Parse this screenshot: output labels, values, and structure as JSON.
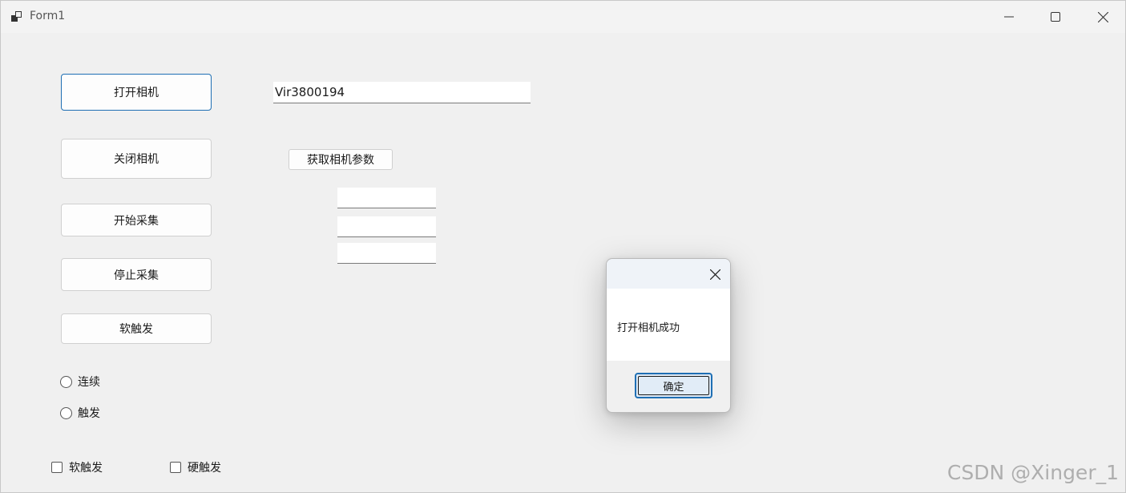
{
  "window": {
    "title": "Form1"
  },
  "buttons": {
    "open_camera": "打开相机",
    "close_camera": "关闭相机",
    "start_capture": "开始采集",
    "stop_capture": "停止采集",
    "soft_trigger": "软触发",
    "get_params": "获取相机参数"
  },
  "inputs": {
    "camera_id": "Vir3800194",
    "param1": "",
    "param2": "",
    "param3": ""
  },
  "radios": {
    "continuous": "连续",
    "trigger": "触发"
  },
  "checkboxes": {
    "soft_trigger": "软触发",
    "hard_trigger": "硬触发"
  },
  "dialog": {
    "message": "打开相机成功",
    "ok_label": "确定"
  },
  "watermark": "CSDN @Xinger_1"
}
